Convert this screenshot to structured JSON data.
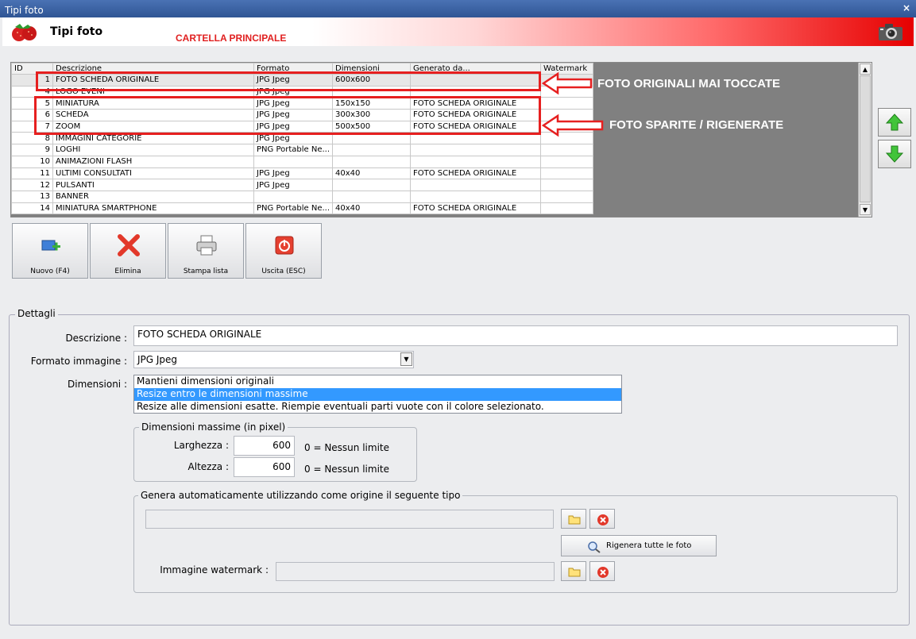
{
  "window": {
    "title": "Tipi foto",
    "close_label": "×"
  },
  "header": {
    "title": "Tipi foto",
    "annotation": "CARTELLA PRINCIPALE"
  },
  "grid": {
    "columns": [
      "ID",
      "Descrizione",
      "Formato",
      "Dimensioni",
      "Generato da...",
      "Watermark"
    ],
    "rows": [
      {
        "id": "1",
        "descr": "FOTO SCHEDA ORIGINALE",
        "formato": "JPG Jpeg",
        "dim": "600x600",
        "gen": "",
        "wm": ""
      },
      {
        "id": "4",
        "descr": "LOGO EVENI",
        "formato": "JPG Jpeg",
        "dim": "",
        "gen": "",
        "wm": ""
      },
      {
        "id": "5",
        "descr": "MINIATURA",
        "formato": "JPG Jpeg",
        "dim": "150x150",
        "gen": "FOTO SCHEDA ORIGINALE",
        "wm": ""
      },
      {
        "id": "6",
        "descr": "SCHEDA",
        "formato": "JPG Jpeg",
        "dim": "300x300",
        "gen": "FOTO SCHEDA ORIGINALE",
        "wm": ""
      },
      {
        "id": "7",
        "descr": "ZOOM",
        "formato": "JPG Jpeg",
        "dim": "500x500",
        "gen": "FOTO SCHEDA ORIGINALE",
        "wm": ""
      },
      {
        "id": "8",
        "descr": "IMMAGINI CATEGORIE",
        "formato": "JPG Jpeg",
        "dim": "",
        "gen": "",
        "wm": ""
      },
      {
        "id": "9",
        "descr": "LOGHI",
        "formato": "PNG Portable Ne...",
        "dim": "",
        "gen": "",
        "wm": ""
      },
      {
        "id": "10",
        "descr": "ANIMAZIONI FLASH",
        "formato": "",
        "dim": "",
        "gen": "",
        "wm": ""
      },
      {
        "id": "11",
        "descr": "ULTIMI CONSULTATI",
        "formato": "JPG Jpeg",
        "dim": "40x40",
        "gen": "FOTO SCHEDA ORIGINALE",
        "wm": ""
      },
      {
        "id": "12",
        "descr": "PULSANTI",
        "formato": "JPG Jpeg",
        "dim": "",
        "gen": "",
        "wm": ""
      },
      {
        "id": "13",
        "descr": "BANNER",
        "formato": "",
        "dim": "",
        "gen": "",
        "wm": ""
      },
      {
        "id": "14",
        "descr": "MINIATURA SMARTPHONE",
        "formato": "PNG Portable Ne...",
        "dim": "40x40",
        "gen": "FOTO SCHEDA ORIGINALE",
        "wm": ""
      }
    ]
  },
  "annotations": {
    "originals": "FOTO ORIGINALI MAI TOCCATE",
    "regenerated": "FOTO SPARITE / RIGENERATE"
  },
  "toolbar": {
    "new_label": "Nuovo (F4)",
    "delete_label": "Elimina",
    "print_label": "Stampa lista",
    "exit_label": "Uscita (ESC)"
  },
  "details": {
    "legend": "Dettagli",
    "descr_label": "Descrizione :",
    "descr_value": "FOTO SCHEDA ORIGINALE",
    "format_label": "Formato immagine :",
    "format_value": "JPG Jpeg",
    "dim_label": "Dimensioni :",
    "dim_options": [
      "Mantieni dimensioni originali",
      "Resize entro le dimensioni massime",
      "Resize alle dimensioni esatte. Riempie eventuali parti vuote con il colore selezionato."
    ],
    "max_dim": {
      "legend": "Dimensioni massime (in pixel)",
      "width_label": "Larghezza :",
      "width_value": "600",
      "height_label": "Altezza :",
      "height_value": "600",
      "no_limit_hint": "0 = Nessun limite"
    },
    "autogen": {
      "legend": "Genera automaticamente utilizzando come origine il seguente tipo",
      "source_value": "",
      "regen_label": "Rigenera tutte le foto",
      "watermark_label": "Immagine watermark :",
      "watermark_value": ""
    }
  },
  "colors": {
    "annotation_red": "#e62020",
    "selection_blue": "#3399ff",
    "title_blue": "#2f5594"
  }
}
